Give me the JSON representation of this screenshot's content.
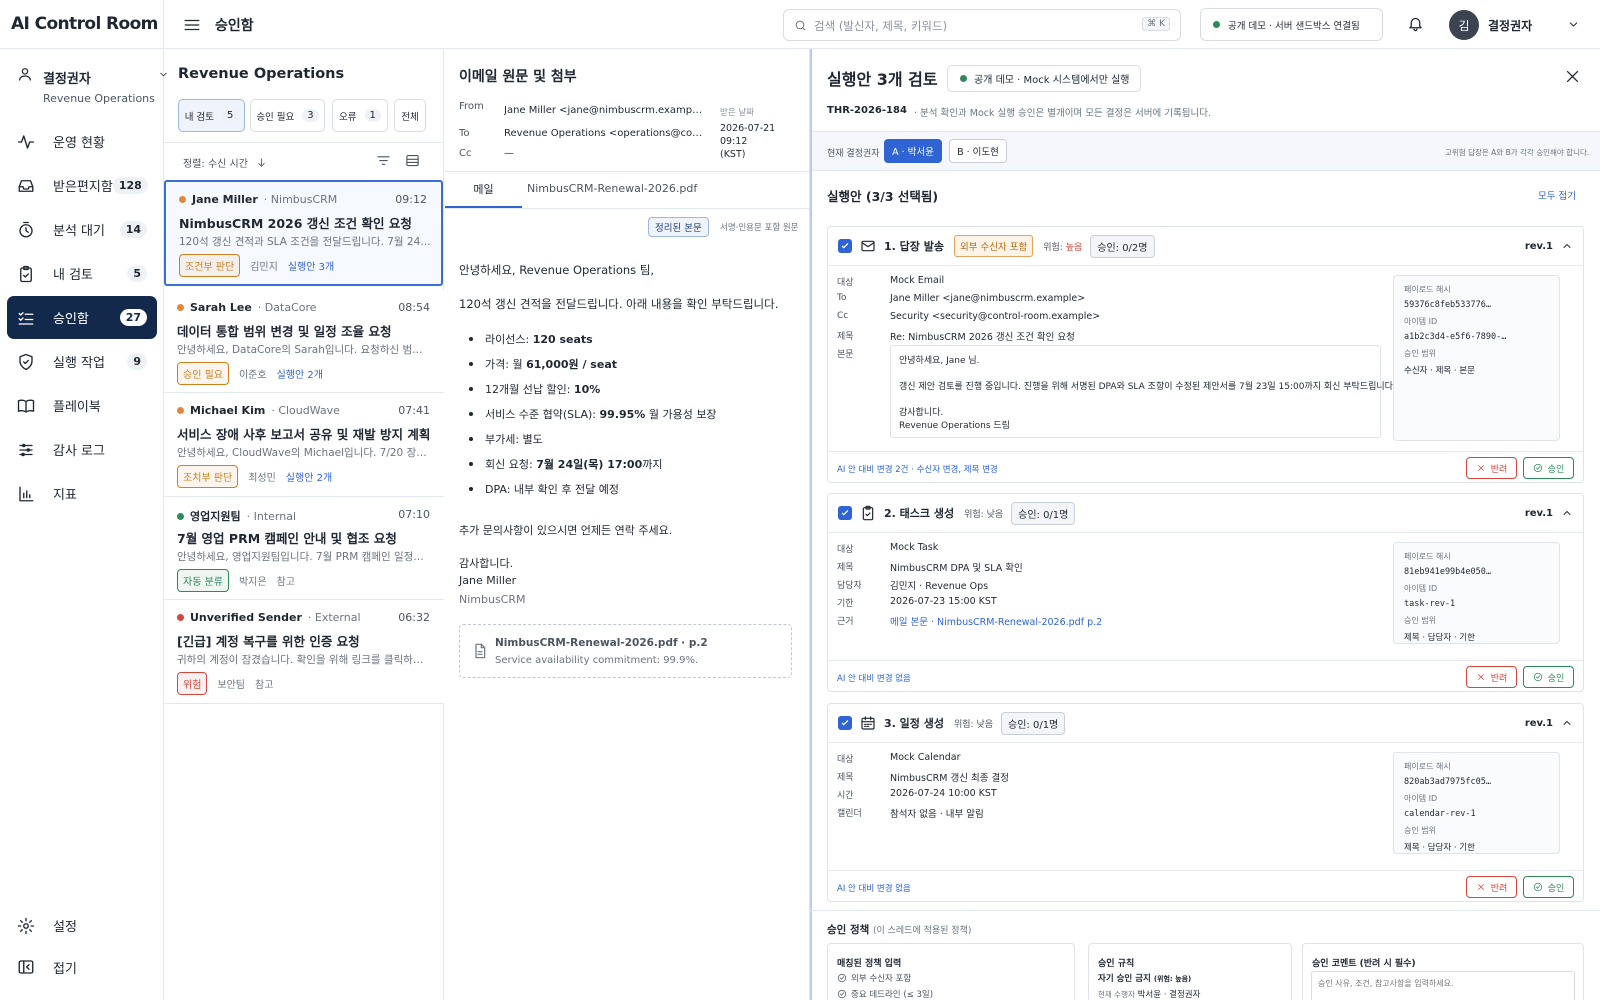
{
  "app": {
    "name": "AI Control Room"
  },
  "sidebar": {
    "user_role": "결정권자",
    "user_team": "Revenue Operations",
    "items": [
      {
        "label": "운영 현황",
        "icon": "activity-icon"
      },
      {
        "label": "받은편지함",
        "count": "128",
        "icon": "inbox-icon"
      },
      {
        "label": "분석 대기",
        "count": "14",
        "icon": "clock-icon"
      },
      {
        "label": "내 검토",
        "count": "5",
        "icon": "clipboard-icon"
      },
      {
        "label": "승인함",
        "count": "27",
        "icon": "checklist-icon",
        "active": true
      },
      {
        "label": "실행 작업",
        "count": "9",
        "icon": "shield-icon"
      },
      {
        "label": "플레이북",
        "icon": "book-icon"
      },
      {
        "label": "감사 로그",
        "icon": "sliders-icon"
      },
      {
        "label": "지표",
        "icon": "bar-chart-icon"
      }
    ],
    "settings": "설정",
    "collapse": "접기"
  },
  "header": {
    "title": "승인함",
    "search_placeholder": "검색 (발신자, 제목, 키워드)",
    "shortcut": "⌘ K",
    "status": "공개 데모 · 서버 샌드박스 연결됨",
    "avatar_initial": "김",
    "user": "결정권자"
  },
  "list": {
    "group": "Revenue Operations",
    "tabs": [
      {
        "label": "내 검토",
        "count": "5"
      },
      {
        "label": "승인 필요",
        "count": "3"
      },
      {
        "label": "오류",
        "count": "1"
      },
      {
        "label": "전체"
      }
    ],
    "sort": "정렬: 수신 시간",
    "cards": [
      {
        "sender": "Jane Miller",
        "company": "NimbusCRM",
        "time": "09:12",
        "title": "NimbusCRM 2026 갱신 조건 확인 요청",
        "preview": "120석 갱신 견적과 SLA 조건을 전달드립니다. 7월 24일까지 회신 부탁드립니다.",
        "badge": "조건부 판단",
        "owner": "김민지",
        "actions": "실행안 3개",
        "dot": "#e5873a",
        "badge_color": "#d0801f"
      },
      {
        "sender": "Sarah Lee",
        "company": "DataCore",
        "time": "08:54",
        "title": "데이터 통합 범위 변경 및 일정 조율 요청",
        "preview": "안녕하세요, DataCore의 Sarah입니다. 요청하신 범위를 반영하여 일정을 조율하고자 합니다.",
        "badge": "승인 필요",
        "owner": "이준호",
        "actions": "실행안 2개",
        "dot": "#e5873a",
        "badge_color": "#d0801f"
      },
      {
        "sender": "Michael Kim",
        "company": "CloudWave",
        "time": "07:41",
        "title": "서비스 장애 사후 보고서 공유 및 재발 방지 계획",
        "preview": "안녕하세요, CloudWave의 Michael입니다. 7/20 장애 보고서를 공유드립니다.",
        "badge": "조치부 판단",
        "owner": "최성민",
        "actions": "실행안 2개",
        "dot": "#e5873a",
        "badge_color": "#d0801f"
      },
      {
        "sender": "영업지원팀",
        "company": "Internal",
        "time": "07:10",
        "title": "7월 영업 PRM 캠페인 안내 및 협조 요청",
        "preview": "안녕하세요, 영업지원팀입니다. 7월 PRM 캠페인 일정을 공유드립니다.",
        "badge": "자동 분류",
        "owner": "박지은",
        "actions": "참고",
        "dot": "#2f8a5a",
        "badge_color": "#2f8a5a"
      },
      {
        "sender": "Unverified Sender",
        "company": "External",
        "time": "06:32",
        "title": "[긴급] 계정 복구를 위한 인증 요청",
        "preview": "귀하의 계정이 잠겼습니다. 확인을 위해 링크를 클릭하십시오.",
        "badge": "위험",
        "owner": "보안팀",
        "actions": "참고",
        "dot": "#d5473b",
        "badge_color": "#d5473b"
      }
    ]
  },
  "email": {
    "heading": "이메일 원문 및 첨부",
    "from_label": "From",
    "from": "Jane Miller <jane@nimbuscrm.example> ...",
    "to_label": "To",
    "to": "Revenue Operations <operations@control...",
    "cc_label": "Cc",
    "cc": "—",
    "received_label": "받은 날짜",
    "received_date": "2026-07-21",
    "received_time": "09:12",
    "received_tz": "(KST)",
    "tabs": [
      "메일",
      "NimbusCRM-Renewal-2026.pdf"
    ],
    "view_clean": "정리된 본문",
    "view_raw": "서명·인용문 포함 원문",
    "greeting": "안녕하세요, Revenue Operations 팀,",
    "intro": "120석 갱신 견적을 전달드립니다. 아래 내용을 확인 부탁드립니다.",
    "bullets": [
      {
        "pre": "라이선스: ",
        "bold": "120 seats",
        "post": ""
      },
      {
        "pre": "가격: 월 ",
        "bold": "61,000원 / seat",
        "post": ""
      },
      {
        "pre": "12개월 선납 할인: ",
        "bold": "10%",
        "post": ""
      },
      {
        "pre": "서비스 수준 협약(SLA): ",
        "bold": "99.95%",
        "post": " 월 가용성 보장"
      },
      {
        "pre": "부가세: 별도",
        "bold": "",
        "post": ""
      },
      {
        "pre": "회신 요청: ",
        "bold": "7월 24일(목) 17:00",
        "post": "까지"
      },
      {
        "pre": "DPA: 내부 확인 후 전달 예정",
        "bold": "",
        "post": ""
      }
    ],
    "closing": "추가 문의사항이 있으시면 언제든 연락 주세요.",
    "thanks": "감사합니다.",
    "sign_name": "Jane Miller",
    "sign_co": "NimbusCRM",
    "attachment_name": "NimbusCRM-Renewal-2026.pdf · p.2",
    "attachment_quote": "Service availability commitment: 99.9%."
  },
  "panel": {
    "title": "실행안 3개 검토",
    "demo_badge": "공개 데모 · Mock 시스템에서만 실행",
    "thread_id": "THR-2026-184",
    "thread_note": "· 분석 확인과 Mock 실행 승인은 별개이며 모든 결정은 서버에 기록됩니다.",
    "decider_label": "현재 결정권자",
    "decider_a": "A · 박서윤",
    "decider_b": "B · 이도현",
    "risk_note": "고위험 답장은 A와 B가 각각 승인해야 합니다.",
    "section": "실행안 (3/3 선택됨)",
    "collapse_all": "모두 접기",
    "actions": [
      {
        "title": "1. 답장 발송",
        "icon": "mail-icon",
        "tag": "외부 수신자 포함",
        "risk_label": "위험:",
        "risk": "높음",
        "approval": "승인: 0/2명",
        "rev": "rev.1",
        "fields": [
          {
            "k": "대상",
            "v": "Mock Email"
          },
          {
            "k": "To",
            "v": "Jane Miller <jane@nimbuscrm.example>"
          },
          {
            "k": "Cc",
            "v": "Security <security@control-room.example>"
          },
          {
            "k": "제목",
            "v": "Re: NimbusCRM 2026 갱신 조건 확인 요청"
          }
        ],
        "body_label": "본문",
        "body": [
          "안녕하세요, Jane 님.",
          "갱신 제안 검토를 진행 중입니다. 진행을 위해 서명된 DPA와 SLA 조항이 수정된 제안서를 7월 23일 15:00까지 회신 부탁드립니다.",
          "감사합니다.",
          "Revenue Operations 드림"
        ],
        "side": [
          {
            "k": "페이로드 해시",
            "v": "59376c8feb533776…"
          },
          {
            "k": "아이템 ID",
            "v": "a1b2c3d4-e5f6-7890-…"
          },
          {
            "k": "승인 범위",
            "v": "수신자 · 제목 · 본문"
          }
        ],
        "foot_note": "AI 안 대비 변경 2건 · 수신자 변경, 제목 변경"
      },
      {
        "title": "2. 태스크 생성",
        "icon": "clipboard-icon",
        "risk_label": "위험:",
        "risk": "낮음",
        "approval": "승인: 0/1명",
        "rev": "rev.1",
        "fields": [
          {
            "k": "대상",
            "v": "Mock Task"
          },
          {
            "k": "제목",
            "v": "NimbusCRM DPA 및 SLA 확인"
          },
          {
            "k": "담당자",
            "v": "김민지 · Revenue Ops"
          },
          {
            "k": "기한",
            "v": "2026-07-23 15:00 KST"
          },
          {
            "k": "근거",
            "v": "메일 본문 · NimbusCRM-Renewal-2026.pdf p.2"
          }
        ],
        "side": [
          {
            "k": "페이로드 해시",
            "v": "81eb941e99b4e050…"
          },
          {
            "k": "아이템 ID",
            "v": "task-rev-1"
          },
          {
            "k": "승인 범위",
            "v": "제목 · 담당자 · 기한"
          }
        ],
        "foot_note": "AI 안 대비 변경 없음"
      },
      {
        "title": "3. 일정 생성",
        "icon": "calendar-icon",
        "risk_label": "위험:",
        "risk": "낮음",
        "approval": "승인: 0/1명",
        "rev": "rev.1",
        "fields": [
          {
            "k": "대상",
            "v": "Mock Calendar"
          },
          {
            "k": "제목",
            "v": "NimbusCRM 갱신 최종 결정"
          },
          {
            "k": "시간",
            "v": "2026-07-24 10:00 KST"
          },
          {
            "k": "캘린더",
            "v": "참석자 없음 · 내부 알림"
          }
        ],
        "side": [
          {
            "k": "페이로드 해시",
            "v": "820ab3ad7975fc05…"
          },
          {
            "k": "아이템 ID",
            "v": "calendar-rev-1"
          },
          {
            "k": "승인 범위",
            "v": "제목 · 담당자 · 기한"
          }
        ],
        "foot_note": "AI 안 대비 변경 없음"
      }
    ],
    "reject_label": "반려",
    "approve_label": "승인",
    "policy_title": "승인 정책",
    "policy_sub": "(이 스레드에 적용된 정책)",
    "policy_input_title": "매칭된 정책 입력",
    "policy_inputs": [
      "외부 수신자 포함",
      "중요 데드라인 (≤ 3일)"
    ],
    "rule_title": "승인 규칙",
    "rule_line": "자기 승인 금지",
    "rule_line_note": "(위험: 높음)",
    "rule_current_label": "현재 수행자",
    "rule_current": "박서윤 · 결정권자",
    "comment_title": "승인 코멘트 (반려 시 필수)",
    "comment_placeholder": "승인 사유, 조건, 참고사항을 입력하세요."
  },
  "colors": {
    "accent": "#2f64d2",
    "nav_active": "#13294b",
    "danger": "#d5473b",
    "success": "#2f8a5a",
    "warn": "#d0801f"
  }
}
